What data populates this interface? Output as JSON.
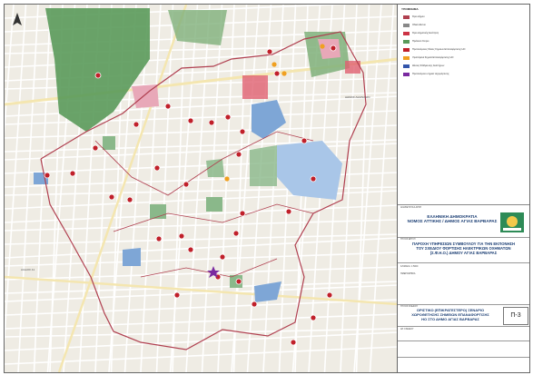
{
  "map": {
    "street_labels": [
      "ΑΙΑΞΟΣ 41",
      "ΔΗΜΟΣ ΑΘΗΝΑΙΩΝ",
      "ΔΗΜΟΣ ΠΕΡΙΣΤΕΡΙΟΥ"
    ],
    "colors": {
      "park": "#5a9a5a",
      "blue_zone": "#7ea6d6",
      "pink_zone": "#e8a8b8",
      "route": "#b04050",
      "charger": "#c0202a",
      "road": "#ffffff",
      "block": "#ece8df"
    },
    "icons": [
      "north-arrow-icon",
      "charger-point-icon",
      "station-icon",
      "star-icon"
    ]
  },
  "legend": {
    "title": "ΥΠΟΜΝΗΜΑ",
    "items": [
      {
        "label": "Όριο Δήμου",
        "color": "#b04050"
      },
      {
        "label": "Οδικό Δίκτυο",
        "color": "#888888"
      },
      {
        "label": "Όριο Δημοτικής Ενότητας",
        "color": "#cc3344"
      },
      {
        "label": "Πράσινοι Χώροι",
        "color": "#5a9a5a"
      },
      {
        "label": "Προτεινόμενες θέσεις Σημείων Επαναφόρτισης ΗΟ",
        "color": "#c0202a"
      },
      {
        "label": "Υφιστάμενα Σημεία Επαναφόρτισης ΗΟ",
        "color": "#f0a020"
      },
      {
        "label": "Θέσεις Στάθμευσης Αναπήρων",
        "color": "#3355aa"
      },
      {
        "label": "Προτεινόμενο σημείο ταχυφόρτισης",
        "color": "#7a2aa0"
      }
    ]
  },
  "title_block": {
    "country": "ΕΛΛΗΝΙΚΗ ΔΗΜΟΚΡΑΤΙΑ",
    "municipality": "ΝΟΜΟΣ ΑΤΤΙΚΗΣ / ΔΗΜΟΣ ΑΓΙΑΣ ΒΑΡΒΑΡΑΣ",
    "project_l1": "ΠΑΡΟΧΗ ΥΠΗΡΕΣΙΩΝ ΣΥΜΒΟΥΛΟΥ ΓΙΑ ΤΗΝ ΕΚΠΟΝΗΣΗ",
    "project_l2": "ΤΟΥ ΣΧΕΔΙΟΥ ΦΟΡΤΙΣΗΣ ΗΛΕΚΤΡΙΚΩΝ ΟΧΗΜΑΤΩΝ",
    "project_l3": "(Σ.Φ.Η.Ο.) ΔΗΜΟΥ ΑΓΙΑΣ ΒΑΡΒΑΡΑΣ",
    "drawing_l1": "ΟΡΙΣΤΙΚΟ (ΕΠΙΚΡΑΤΕΣΤΕΡΟ) ΣΕΝΑΡΙΟ",
    "drawing_l2": "ΧΩΡΟΘΕΤΗΣΗΣ ΣΗΜΕΙΩΝ ΕΠΑΝΑΦΟΡΤΙΣΗΣ",
    "drawing_l3": "ΗΟ ΣΤΟ ΔΗΜΟ ΑΓΙΑΣ ΒΑΡΒΑΡΑΣ",
    "sheet_number": "Π-3",
    "small_1": "ΑΝΑΘΕΤΟΥΣΑ ΑΡΧΗ",
    "small_2": "ΤΙΤΛΟΣ ΕΡΓΟΥ",
    "small_3": "ΤΙΤΛΟΣ ΣΧΕΔΙΟΥ",
    "small_4": "ΚΛΙΜΑΚΑ: 1:5000",
    "small_5": "ΗΜΕΡΟΜΗΝΙΑ",
    "small_6": "ΑΡ. ΣΧΕΔΙΟΥ"
  }
}
